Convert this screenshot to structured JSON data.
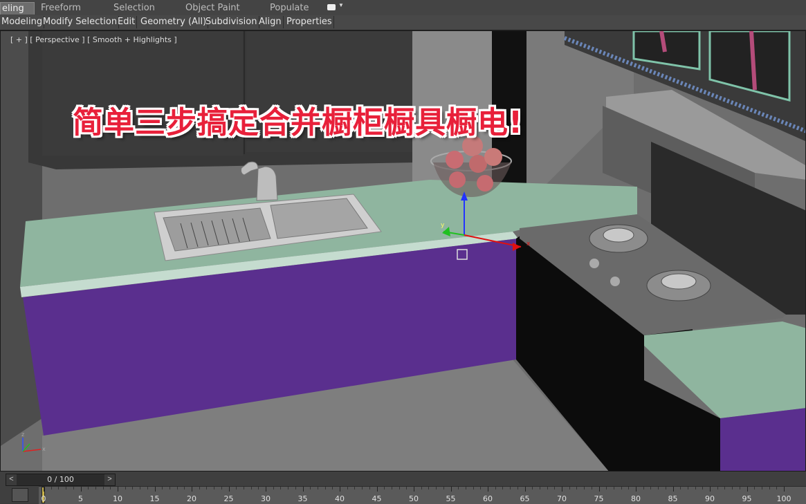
{
  "ribbon": {
    "tabs": [
      "eling",
      "Freeform",
      "Selection",
      "Object Paint",
      "Populate"
    ],
    "panels": [
      "Modeling",
      "Modify Selection",
      "Edit",
      "Geometry (All)",
      "Subdivision",
      "Align",
      "Properties"
    ]
  },
  "viewport": {
    "label": "[ + ] [ Perspective ] [ Smooth + Highlights ]",
    "overlay_title": "简单三步搞定合并橱柜橱具橱电!",
    "gizmo_axes": {
      "x": "x",
      "y": "y",
      "z": "z"
    }
  },
  "timeline": {
    "frame_display": "0 / 100",
    "prev": "<",
    "next": ">",
    "ticks": [
      "0",
      "5",
      "10",
      "15",
      "20",
      "25",
      "30",
      "35",
      "40",
      "45",
      "50",
      "55",
      "60",
      "65",
      "70",
      "75",
      "80",
      "85",
      "90",
      "95",
      "100"
    ]
  },
  "colors": {
    "counter": "#8fb59f",
    "cabinet": "#5a2f8e",
    "overlay_text": "#e8203a"
  }
}
